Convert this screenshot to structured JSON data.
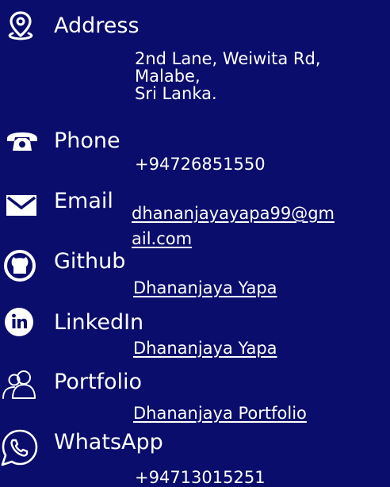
{
  "contacts": {
    "address": {
      "title": "Address",
      "lines": "2nd Lane, Weiwita Rd,\nMalabe,\nSri Lanka."
    },
    "phone": {
      "title": "Phone",
      "value": "+94726851550"
    },
    "email": {
      "title": "Email",
      "line1": "dhananjayayapa99@gm",
      "line2": "ail.com"
    },
    "github": {
      "title": "Github",
      "value": "Dhananjaya Yapa"
    },
    "linkedin": {
      "title": "LinkedIn",
      "value": "Dhananjaya Yapa"
    },
    "portfolio": {
      "title": "Portfolio",
      "value": "Dhananjaya Portfolio"
    },
    "whatsapp": {
      "title": "WhatsApp",
      "value": "+94713015251"
    }
  },
  "colors": {
    "background": "#0a0d6b",
    "text": "#ffffff"
  },
  "icons": [
    "location-pin-icon",
    "phone-icon",
    "mail-icon",
    "github-icon",
    "linkedin-icon",
    "users-icon",
    "whatsapp-icon"
  ]
}
